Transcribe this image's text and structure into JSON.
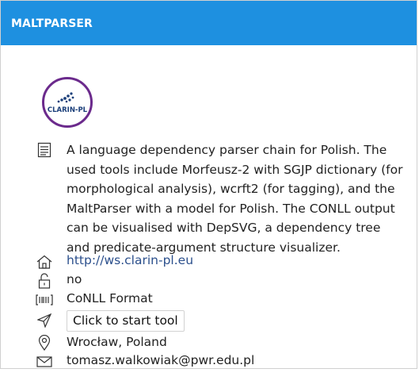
{
  "header": {
    "title": "MALTPARSER"
  },
  "logo": {
    "text": "CLARIN-PL"
  },
  "description": "A language dependency parser chain for Polish. The used tools include Morfeusz-2 with SGJP dictionary (for morphological analysis), wcrft2 (for tagging), and the MaltParser with a model for Polish. The CONLL output can be visualised with DepSVG, a dependency tree and predicate-argument structure visualizer.",
  "homepage": "http://ws.clarin-pl.eu",
  "login_required": "no",
  "format": "CoNLL Format",
  "start_button": "Click to start tool",
  "location": "Wrocław, Poland",
  "email": "tomasz.walkowiak@pwr.edu.pl",
  "colors": {
    "header": "#1e90e0",
    "logo_ring": "#6b2a8c",
    "link": "#2b4f8c"
  },
  "icons": [
    "document-icon",
    "home-icon",
    "unlock-icon",
    "barcode-icon",
    "send-icon",
    "map-pin-icon",
    "envelope-icon"
  ]
}
